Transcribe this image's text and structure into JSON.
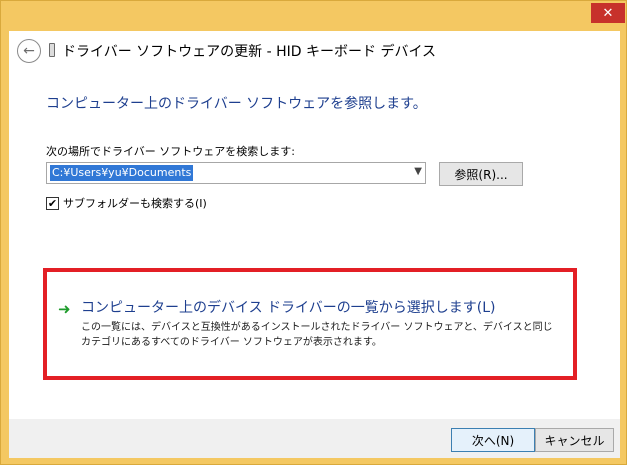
{
  "window": {
    "title": "ドライバー ソフトウェアの更新 - HID キーボード デバイス",
    "close_glyph": "✕"
  },
  "main": {
    "heading": "コンピューター上のドライバー ソフトウェアを参照します。",
    "search_label": "次の場所でドライバー ソフトウェアを検索します:",
    "path_value": "C:¥Users¥yu¥Documents",
    "browse_label": "参照(R)...",
    "subfolder_label": "サブフォルダーも検索する(I)",
    "subfolder_checked": true
  },
  "option": {
    "title": "コンピューター上のデバイス ドライバーの一覧から選択します(L)",
    "description": "この一覧には、デバイスと互換性があるインストールされたドライバー ソフトウェアと、デバイスと同じカテゴリにあるすべてのドライバー ソフトウェアが表示されます。"
  },
  "footer": {
    "next_label": "次へ(N)",
    "cancel_label": "キャンセル"
  },
  "icons": {
    "back": "back-arrow-icon",
    "device": "usb-device-icon",
    "option_arrow": "green-arrow-icon",
    "combo": "chevron-down-icon"
  },
  "colors": {
    "frame": "#f4c862",
    "close": "#c7312b",
    "link_blue": "#1e3f8f",
    "highlight_red": "#e31f25",
    "selection": "#3178d6",
    "arrow_green": "#1f9c2c"
  }
}
